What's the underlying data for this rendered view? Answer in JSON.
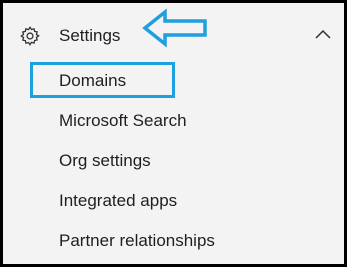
{
  "nav": {
    "header": {
      "label": "Settings",
      "icon": "gear-icon",
      "expand_icon": "chevron-up-icon"
    },
    "items": [
      {
        "label": "Domains",
        "highlighted": true
      },
      {
        "label": "Microsoft Search"
      },
      {
        "label": "Org settings"
      },
      {
        "label": "Integrated apps"
      },
      {
        "label": "Partner relationships"
      }
    ]
  },
  "colors": {
    "background": "#f3f3f3",
    "text": "#201f1e",
    "annotation": "#1ea0e0",
    "frame": "#000000"
  }
}
